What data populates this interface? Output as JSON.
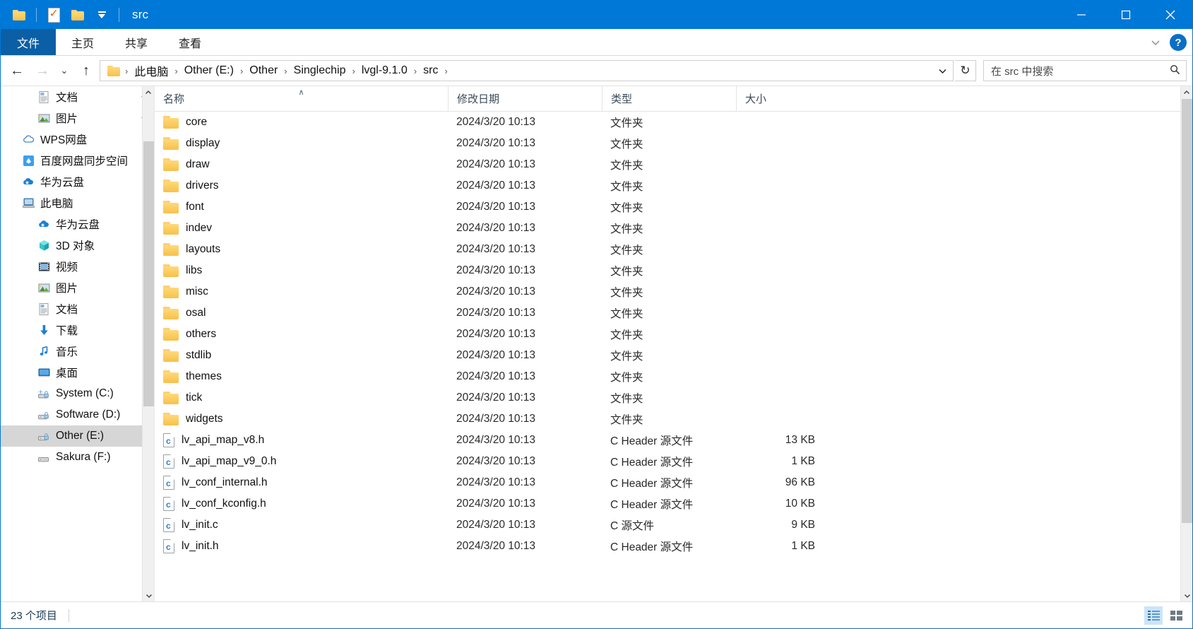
{
  "window": {
    "title": "src",
    "quick_access": [
      {
        "name": "folder-icon",
        "label": "folder"
      },
      {
        "name": "properties-icon",
        "label": "properties"
      },
      {
        "name": "new-folder-icon",
        "label": "new folder"
      },
      {
        "name": "customize-quick-access-icon",
        "label": "customize"
      }
    ],
    "controls": {
      "minimize": "minimize",
      "maximize": "maximize",
      "close": "close"
    }
  },
  "ribbon": {
    "tabs": [
      {
        "label": "文件",
        "active": true
      },
      {
        "label": "主页",
        "active": false
      },
      {
        "label": "共享",
        "active": false
      },
      {
        "label": "查看",
        "active": false
      }
    ],
    "expand_label": "展开",
    "help_label": "?"
  },
  "addressbar": {
    "back": "←",
    "forward": "→",
    "recent": "⌄",
    "up": "↑",
    "crumbs": [
      "此电脑",
      "Other (E:)",
      "Other",
      "Singlechip",
      "lvgl-9.1.0",
      "src"
    ],
    "separator": "›",
    "dropdown": "⌄",
    "refresh": "↻"
  },
  "search": {
    "placeholder": "在 src 中搜索",
    "icon": "search-icon"
  },
  "sidebar": {
    "items": [
      {
        "label": "文档",
        "icon": "document-icon",
        "indent": "nav-l2",
        "pinned": true,
        "selected": false
      },
      {
        "label": "图片",
        "icon": "picture-icon",
        "indent": "nav-l2",
        "pinned": true,
        "selected": false
      },
      {
        "label": "WPS网盘",
        "icon": "cloud-icon",
        "indent": "nav-l1",
        "pinned": false,
        "selected": false
      },
      {
        "label": "百度网盘同步空间",
        "icon": "baidu-netdisk-icon",
        "indent": "nav-l1",
        "pinned": false,
        "selected": false
      },
      {
        "label": "华为云盘",
        "icon": "huawei-cloud-icon",
        "indent": "nav-l1",
        "pinned": false,
        "selected": false
      },
      {
        "label": "此电脑",
        "icon": "this-pc-icon",
        "indent": "nav-l1",
        "pinned": false,
        "selected": false
      },
      {
        "label": "华为云盘",
        "icon": "huawei-cloud-icon",
        "indent": "nav-l2",
        "pinned": false,
        "selected": false
      },
      {
        "label": "3D 对象",
        "icon": "3d-objects-icon",
        "indent": "nav-l2",
        "pinned": false,
        "selected": false
      },
      {
        "label": "视频",
        "icon": "videos-icon",
        "indent": "nav-l2",
        "pinned": false,
        "selected": false
      },
      {
        "label": "图片",
        "icon": "picture-icon",
        "indent": "nav-l2",
        "pinned": false,
        "selected": false
      },
      {
        "label": "文档",
        "icon": "document-icon",
        "indent": "nav-l2",
        "pinned": false,
        "selected": false
      },
      {
        "label": "下载",
        "icon": "downloads-icon",
        "indent": "nav-l2",
        "pinned": false,
        "selected": false
      },
      {
        "label": "音乐",
        "icon": "music-icon",
        "indent": "nav-l2",
        "pinned": false,
        "selected": false
      },
      {
        "label": "桌面",
        "icon": "desktop-icon",
        "indent": "nav-l2",
        "pinned": false,
        "selected": false
      },
      {
        "label": "System (C:)",
        "icon": "system-drive-icon",
        "indent": "nav-l2",
        "pinned": false,
        "selected": false
      },
      {
        "label": "Software (D:)",
        "icon": "drive-icon",
        "indent": "nav-l2",
        "pinned": false,
        "selected": false
      },
      {
        "label": "Other (E:)",
        "icon": "drive-icon",
        "indent": "nav-l2",
        "pinned": false,
        "selected": true
      },
      {
        "label": "Sakura (F:)",
        "icon": "drive-plain-icon",
        "indent": "nav-l2",
        "pinned": false,
        "selected": false
      }
    ]
  },
  "filelist": {
    "columns": [
      {
        "label": "名称",
        "sorted": "asc",
        "sort_glyph": "∧"
      },
      {
        "label": "修改日期",
        "sorted": "",
        "sort_glyph": ""
      },
      {
        "label": "类型",
        "sorted": "",
        "sort_glyph": ""
      },
      {
        "label": "大小",
        "sorted": "",
        "sort_glyph": ""
      }
    ],
    "rows": [
      {
        "name": "core",
        "date": "2024/3/20 10:13",
        "type": "文件夹",
        "size": "",
        "kind": "folder"
      },
      {
        "name": "display",
        "date": "2024/3/20 10:13",
        "type": "文件夹",
        "size": "",
        "kind": "folder"
      },
      {
        "name": "draw",
        "date": "2024/3/20 10:13",
        "type": "文件夹",
        "size": "",
        "kind": "folder"
      },
      {
        "name": "drivers",
        "date": "2024/3/20 10:13",
        "type": "文件夹",
        "size": "",
        "kind": "folder"
      },
      {
        "name": "font",
        "date": "2024/3/20 10:13",
        "type": "文件夹",
        "size": "",
        "kind": "folder"
      },
      {
        "name": "indev",
        "date": "2024/3/20 10:13",
        "type": "文件夹",
        "size": "",
        "kind": "folder"
      },
      {
        "name": "layouts",
        "date": "2024/3/20 10:13",
        "type": "文件夹",
        "size": "",
        "kind": "folder"
      },
      {
        "name": "libs",
        "date": "2024/3/20 10:13",
        "type": "文件夹",
        "size": "",
        "kind": "folder"
      },
      {
        "name": "misc",
        "date": "2024/3/20 10:13",
        "type": "文件夹",
        "size": "",
        "kind": "folder"
      },
      {
        "name": "osal",
        "date": "2024/3/20 10:13",
        "type": "文件夹",
        "size": "",
        "kind": "folder"
      },
      {
        "name": "others",
        "date": "2024/3/20 10:13",
        "type": "文件夹",
        "size": "",
        "kind": "folder"
      },
      {
        "name": "stdlib",
        "date": "2024/3/20 10:13",
        "type": "文件夹",
        "size": "",
        "kind": "folder"
      },
      {
        "name": "themes",
        "date": "2024/3/20 10:13",
        "type": "文件夹",
        "size": "",
        "kind": "folder"
      },
      {
        "name": "tick",
        "date": "2024/3/20 10:13",
        "type": "文件夹",
        "size": "",
        "kind": "folder"
      },
      {
        "name": "widgets",
        "date": "2024/3/20 10:13",
        "type": "文件夹",
        "size": "",
        "kind": "folder"
      },
      {
        "name": "lv_api_map_v8.h",
        "date": "2024/3/20 10:13",
        "type": "C Header 源文件",
        "size": "13 KB",
        "kind": "cfile"
      },
      {
        "name": "lv_api_map_v9_0.h",
        "date": "2024/3/20 10:13",
        "type": "C Header 源文件",
        "size": "1 KB",
        "kind": "cfile"
      },
      {
        "name": "lv_conf_internal.h",
        "date": "2024/3/20 10:13",
        "type": "C Header 源文件",
        "size": "96 KB",
        "kind": "cfile"
      },
      {
        "name": "lv_conf_kconfig.h",
        "date": "2024/3/20 10:13",
        "type": "C Header 源文件",
        "size": "10 KB",
        "kind": "cfile"
      },
      {
        "name": "lv_init.c",
        "date": "2024/3/20 10:13",
        "type": "C 源文件",
        "size": "9 KB",
        "kind": "cfile"
      },
      {
        "name": "lv_init.h",
        "date": "2024/3/20 10:13",
        "type": "C Header 源文件",
        "size": "1 KB",
        "kind": "cfile"
      }
    ]
  },
  "statusbar": {
    "item_count": "23 个项目",
    "views": [
      {
        "name": "details-view-button",
        "active": true
      },
      {
        "name": "large-icons-view-button",
        "active": false
      }
    ]
  },
  "colors": {
    "accent": "#0078d7",
    "file_tab": "#0a5fa5",
    "selection": "#d6d6d6",
    "folder_yellow": "#f7c14a",
    "column_header_text": "#3b4a5a"
  }
}
